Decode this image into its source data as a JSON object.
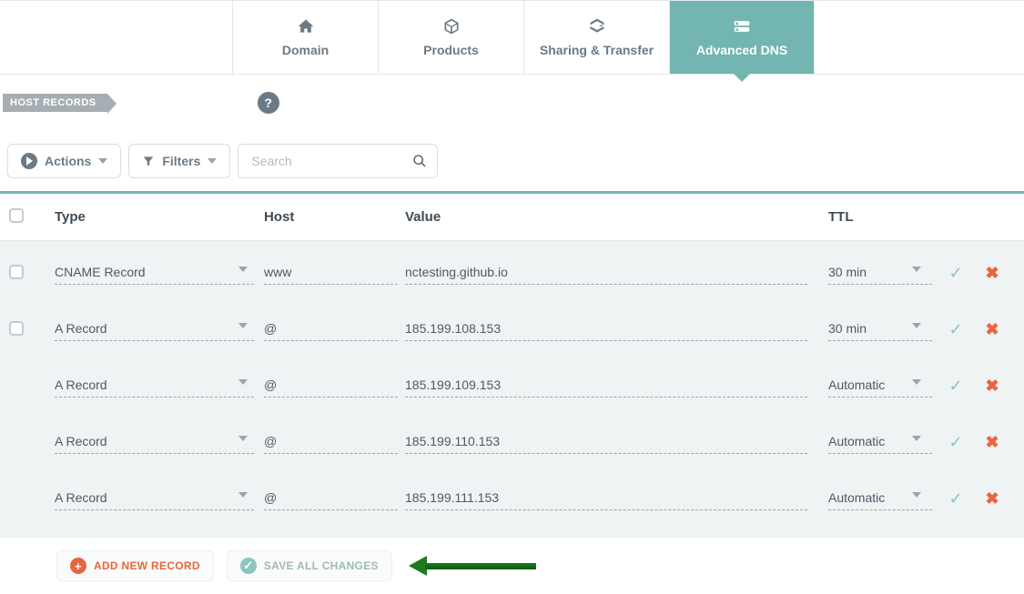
{
  "tabs": [
    {
      "label": "Domain"
    },
    {
      "label": "Products"
    },
    {
      "label": "Sharing & Transfer"
    },
    {
      "label": "Advanced DNS"
    }
  ],
  "activeTabIndex": 3,
  "section": {
    "title": "HOST RECORDS",
    "help": "?"
  },
  "toolbar": {
    "actions_label": "Actions",
    "filters_label": "Filters",
    "search_placeholder": "Search"
  },
  "columns": {
    "type": "Type",
    "host": "Host",
    "value": "Value",
    "ttl": "TTL"
  },
  "rows": [
    {
      "checkbox": true,
      "type": "CNAME Record",
      "host": "www",
      "value": "nctesting.github.io",
      "ttl": "30 min"
    },
    {
      "checkbox": true,
      "type": "A Record",
      "host": "@",
      "value": "185.199.108.153",
      "ttl": "30 min"
    },
    {
      "checkbox": false,
      "type": "A Record",
      "host": "@",
      "value": "185.199.109.153",
      "ttl": "Automatic"
    },
    {
      "checkbox": false,
      "type": "A Record",
      "host": "@",
      "value": "185.199.110.153",
      "ttl": "Automatic"
    },
    {
      "checkbox": false,
      "type": "A Record",
      "host": "@",
      "value": "185.199.111.153",
      "ttl": "Automatic"
    }
  ],
  "footer": {
    "add_label": "ADD NEW RECORD",
    "save_label": "SAVE ALL CHANGES"
  },
  "glyphs": {
    "check": "✓",
    "close": "✖",
    "plus": "+"
  }
}
